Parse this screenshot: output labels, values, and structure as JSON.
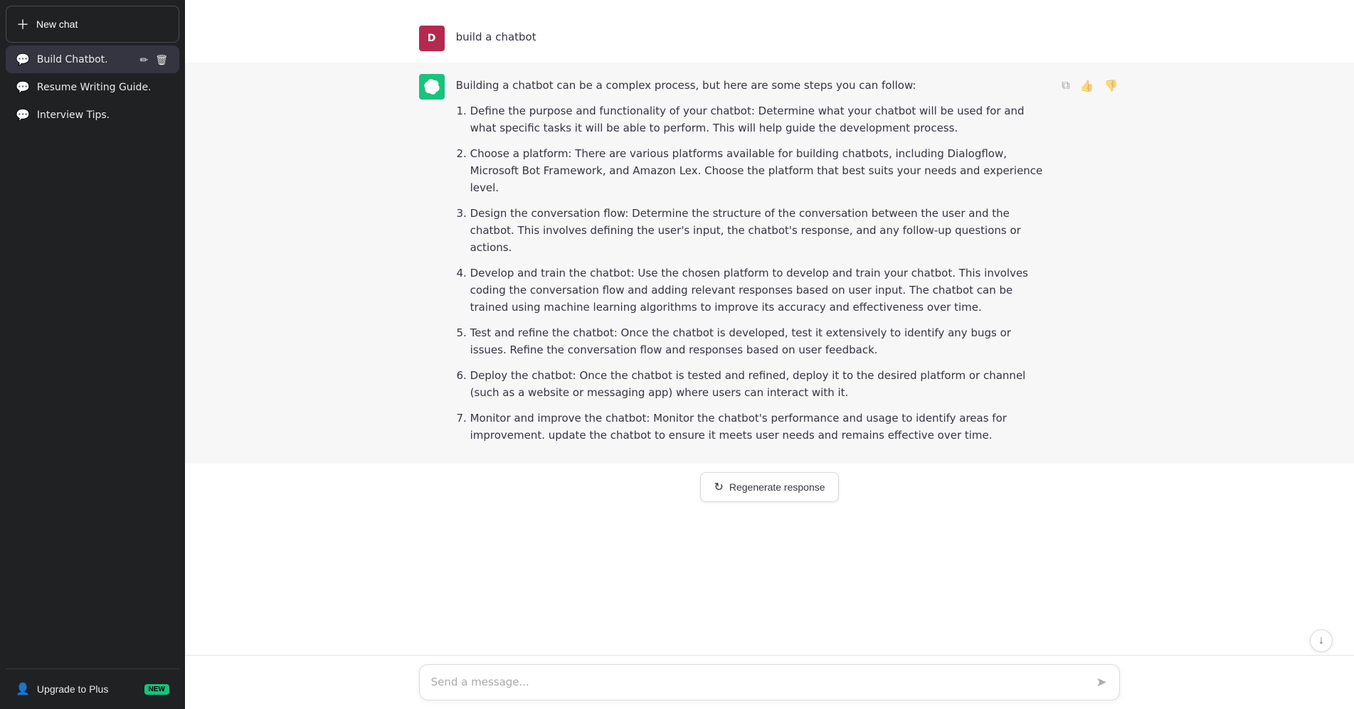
{
  "sidebar": {
    "new_chat_label": "New chat",
    "chats": [
      {
        "id": "build-chatbot",
        "label": "Build Chatbot.",
        "active": true
      },
      {
        "id": "resume-writing",
        "label": "Resume Writing Guide.",
        "active": false
      },
      {
        "id": "interview-tips",
        "label": "Interview Tips.",
        "active": false
      }
    ],
    "upgrade_label": "Upgrade to Plus",
    "new_badge": "NEW"
  },
  "conversation": {
    "user_message": "build a chatbot",
    "user_avatar_letter": "D",
    "ai_intro": "Building a chatbot can be a complex process, but here are some steps you can follow:",
    "steps": [
      {
        "num": 1,
        "text": "Define the purpose and functionality of your chatbot: Determine what your chatbot will be used for and what specific tasks it will be able to perform. This will help guide the development process."
      },
      {
        "num": 2,
        "text": "Choose a platform: There are various platforms available for building chatbots, including Dialogflow, Microsoft Bot Framework, and Amazon Lex. Choose the platform that best suits your needs and experience level."
      },
      {
        "num": 3,
        "text": "Design the conversation flow: Determine the structure of the conversation between the user and the chatbot. This involves defining the user's input, the chatbot's response, and any follow-up questions or actions."
      },
      {
        "num": 4,
        "text": "Develop and train the chatbot: Use the chosen platform to develop and train your chatbot. This involves coding the conversation flow and adding relevant responses based on user input. The chatbot can be trained using machine learning algorithms to improve its accuracy and effectiveness over time."
      },
      {
        "num": 5,
        "text": "Test and refine the chatbot: Once the chatbot is developed, test it extensively to identify any bugs or issues. Refine the conversation flow and responses based on user feedback."
      },
      {
        "num": 6,
        "text": "Deploy the chatbot: Once the chatbot is tested and refined, deploy it to the desired platform or channel (such as a website or messaging app) where users can interact with it."
      },
      {
        "num": 7,
        "text": "Monitor and improve the chatbot: Monitor the chatbot's performance and usage to identify areas for improvement. update the chatbot to ensure it meets user needs and remains effective over time."
      }
    ]
  },
  "input": {
    "placeholder": "Send a message...",
    "send_icon": "➤"
  },
  "regenerate_label": "Regenerate response"
}
